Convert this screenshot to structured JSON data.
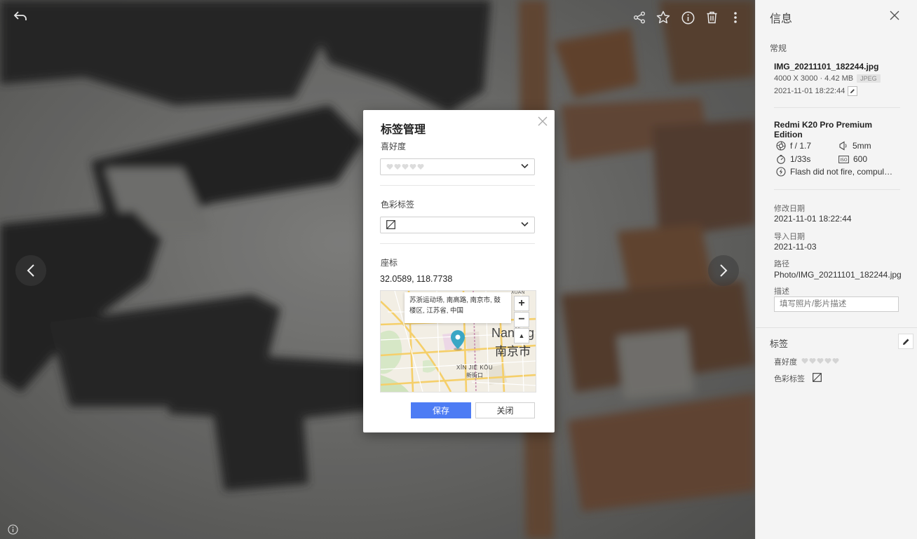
{
  "modal": {
    "title": "标签管理",
    "rating_label": "喜好度",
    "color_label": "色彩标签",
    "coords_label": "座标",
    "coords_value": "32.0589, 118.7738",
    "map": {
      "popup_text": "苏浙运动场, 南高路, 南京市, 鼓楼区, 江苏省, 中国",
      "city_en": "Nanjing",
      "city_zh": "南京市",
      "district_en": "XĪN JIĒ KŎU",
      "district_zh": "新街口",
      "top_label": "XUAN",
      "zoom_in": "+",
      "zoom_out": "−",
      "reset_north": "▲"
    },
    "save_label": "保存",
    "close_label": "关闭"
  },
  "panel": {
    "title": "信息",
    "general_label": "常规",
    "filename": "IMG_20211101_182244.jpg",
    "dims_size": "4000 X 3000 · 4.42 MB",
    "format_badge": "JPEG",
    "taken": "2021-11-01 18:22:44",
    "camera": "Redmi K20 Pro Premium Edition",
    "aperture": "f / 1.7",
    "focal": "5mm",
    "shutter": "1/33s",
    "iso": "600",
    "flash": "Flash did not fire, compul…",
    "modified_label": "修改日期",
    "modified_value": "2021-11-01 18:22:44",
    "imported_label": "导入日期",
    "imported_value": "2021-11-03",
    "path_label": "路径",
    "path_value": "Photo/IMG_20211101_182244.jpg",
    "desc_label": "描述",
    "desc_placeholder": "填写照片/影片描述",
    "tags_label": "标签",
    "rating_label": "喜好度",
    "color_label": "色彩标签"
  },
  "colors": {
    "accent": "#4d7cf4",
    "map_pin": "#3aa6c5",
    "heart_empty": "#dcdcdc"
  },
  "icons": [
    "back-arrow-icon",
    "share-icon",
    "star-icon",
    "info-icon",
    "delete-icon",
    "more-vert-icon",
    "chevron-left-icon",
    "chevron-right-icon",
    "close-icon",
    "chevron-down-icon",
    "no-color-icon",
    "heart-icon",
    "map-pin-icon",
    "aperture-icon",
    "focal-icon",
    "timer-icon",
    "iso-icon",
    "flash-icon",
    "pencil-icon"
  ]
}
